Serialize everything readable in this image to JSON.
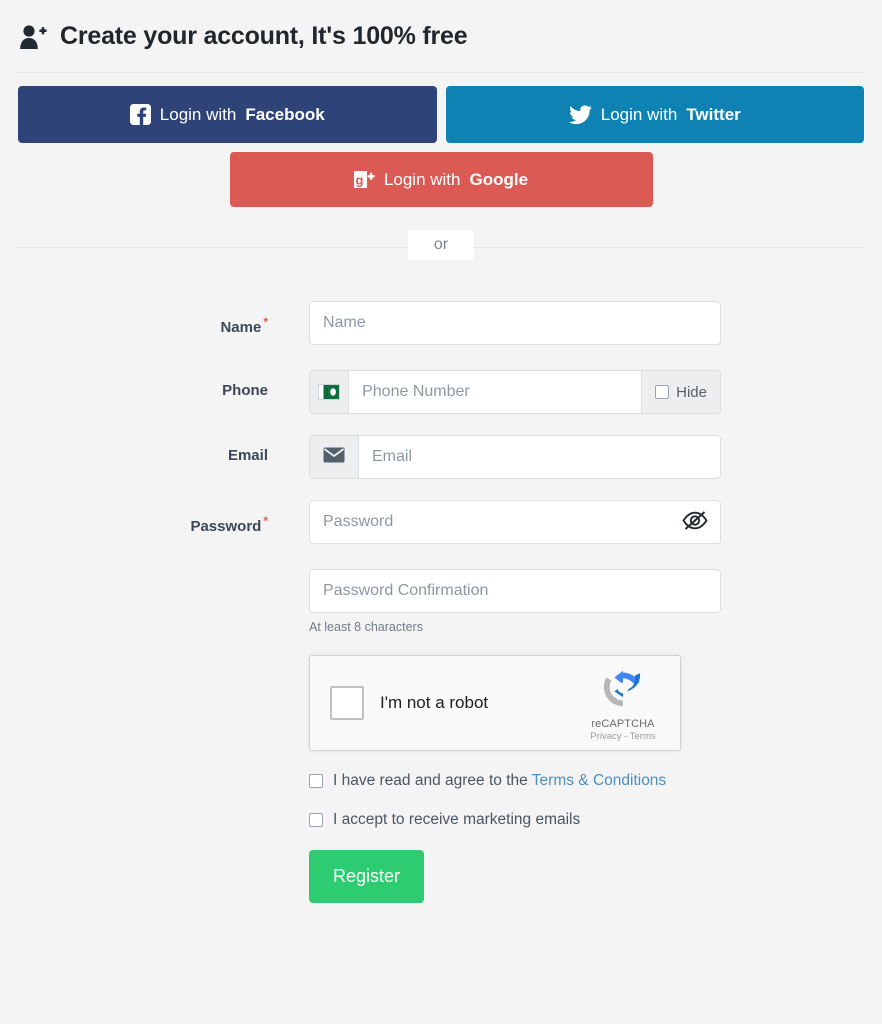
{
  "header": {
    "icon": "user-plus-icon",
    "title": "Create your account, It's 100% free"
  },
  "social": {
    "facebook": {
      "prefix": "Login with ",
      "brand": "Facebook",
      "icon": "facebook-icon",
      "color": "#2e4478"
    },
    "twitter": {
      "prefix": "Login with ",
      "brand": "Twitter",
      "icon": "twitter-icon",
      "color": "#0e82b2"
    },
    "google": {
      "prefix": "Login with ",
      "brand": "Google",
      "icon": "google-plus-icon",
      "color": "#db5a54"
    }
  },
  "divider": {
    "text": "or"
  },
  "form": {
    "name": {
      "label": "Name",
      "required": "*",
      "placeholder": "Name",
      "value": ""
    },
    "phone": {
      "label": "Phone",
      "placeholder": "Phone Number",
      "value": "",
      "flag_icon": "pakistan-flag-icon",
      "hide_label": "Hide",
      "hide_checked": false
    },
    "email": {
      "label": "Email",
      "placeholder": "Email",
      "value": "",
      "icon": "envelope-icon"
    },
    "password": {
      "label": "Password",
      "required": "*",
      "placeholder": "Password",
      "value": "",
      "toggle_icon": "eye-slash-icon"
    },
    "password_confirmation": {
      "placeholder": "Password Confirmation",
      "value": "",
      "hint": "At least 8 characters"
    }
  },
  "recaptcha": {
    "label": "I'm not a robot",
    "brand": "reCAPTCHA",
    "links": "Privacy - Terms",
    "checked": false
  },
  "terms": {
    "agree_prefix": "I have read and agree to the ",
    "agree_link": "Terms & Conditions",
    "agree_checked": false,
    "marketing": "I accept to receive marketing emails",
    "marketing_checked": false
  },
  "submit": {
    "label": "Register",
    "color": "#2ecc71"
  }
}
